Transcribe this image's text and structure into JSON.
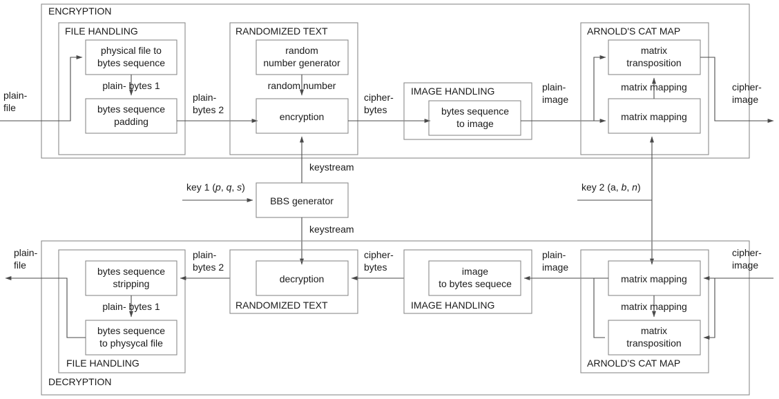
{
  "diagram": {
    "title": "Encryption / Decryption block diagram",
    "sections": {
      "encryption": "ENCRYPTION",
      "decryption": "DECRYPTION",
      "file_handling_top": "FILE HANDLING",
      "randomized_text_top": "RANDOMIZED TEXT",
      "image_handling_top": "IMAGE HANDLING",
      "cat_map_top": "ARNOLD'S CAT MAP",
      "file_handling_bottom": "FILE HANDLING",
      "randomized_text_bottom": "RANDOMIZED TEXT",
      "image_handling_bottom": "IMAGE HANDLING",
      "cat_map_bottom": "ARNOLD'S CAT MAP"
    },
    "blocks": {
      "physical_file_to_bytes_l1": "physical file to",
      "physical_file_to_bytes_l2": "bytes sequence",
      "bytes_padding_l1": "bytes sequence",
      "bytes_padding_l2": "padding",
      "rng_l1": "random",
      "rng_l2": "number generator",
      "encryption": "encryption",
      "bytes_to_image_l1": "bytes sequence",
      "bytes_to_image_l2": "to image",
      "matrix_transposition_top_l1": "matrix",
      "matrix_transposition_top_l2": "transposition",
      "matrix_mapping_top": "matrix mapping",
      "bbs_generator": "BBS generator",
      "bytes_stripping_l1": "bytes sequence",
      "bytes_stripping_l2": "stripping",
      "bytes_to_physical_l1": "bytes sequence",
      "bytes_to_physical_l2": "to physycal file",
      "decryption": "decryption",
      "image_to_bytes_l1": "image",
      "image_to_bytes_l2": "to bytes sequece",
      "matrix_mapping_bottom": "matrix mapping",
      "matrix_transposition_bottom_l1": "matrix",
      "matrix_transposition_bottom_l2": "transposition"
    },
    "edge_labels": {
      "plain_file_top_l1": "plain-",
      "plain_file_top_l2": "file",
      "plain_bytes_1_top": "plain- bytes 1",
      "plain_bytes_2_top_l1": "plain-",
      "plain_bytes_2_top_l2": "bytes 2",
      "random_number": "random number",
      "cipher_bytes_top_l1": "cipher-",
      "cipher_bytes_top_l2": "bytes",
      "plain_image_top_l1": "plain-",
      "plain_image_top_l2": "image",
      "matrix_mapping_label_top": "matrix mapping",
      "cipher_image_top_l1": "cipher-",
      "cipher_image_top_l2": "image",
      "keystream_up": "keystream",
      "keystream_down": "keystream",
      "key1_prefix": "key 1 (",
      "key1_p": "p",
      "key1_sep1": ", ",
      "key1_q": "q",
      "key1_sep2": ", ",
      "key1_s": "s",
      "key1_suffix": ")",
      "key2_prefix": "key 2 (a, ",
      "key2_b": "b",
      "key2_sep": ", ",
      "key2_n": "n",
      "key2_suffix": ")",
      "plain_file_bottom_l1": "plain-",
      "plain_file_bottom_l2": "file",
      "plain_bytes_1_bottom": "plain- bytes 1",
      "plain_bytes_2_bottom_l1": "plain-",
      "plain_bytes_2_bottom_l2": "bytes 2",
      "cipher_bytes_bottom_l1": "cipher-",
      "cipher_bytes_bottom_l2": "bytes",
      "plain_image_bottom_l1": "plain-",
      "plain_image_bottom_l2": "image",
      "matrix_mapping_label_bottom": "matrix mapping",
      "cipher_image_bottom_l1": "cipher-",
      "cipher_image_bottom_l2": "image"
    },
    "colors": {
      "box_stroke": "#8a8a8a",
      "wire_stroke": "#4a4a4a",
      "text": "#1a1a1a",
      "background": "#ffffff"
    }
  }
}
